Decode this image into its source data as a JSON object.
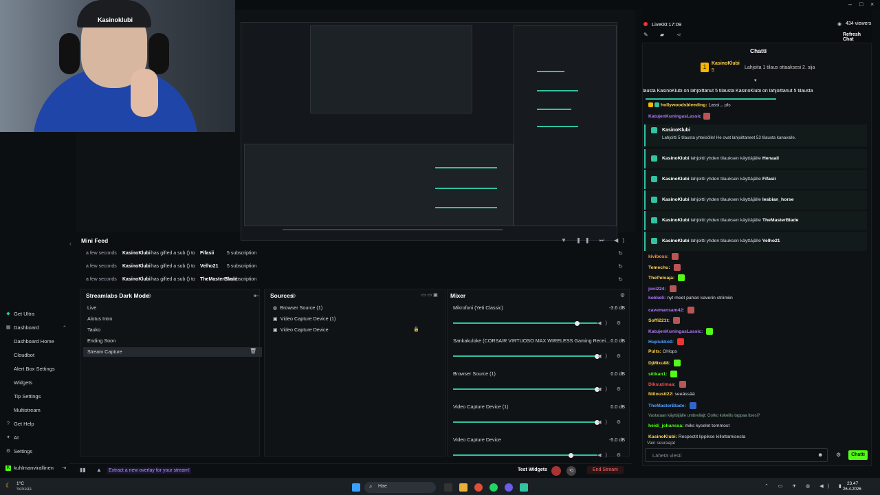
{
  "window": {
    "controls": [
      "–",
      "□",
      "×"
    ]
  },
  "webcam": {
    "cap_text": "Kasinoklubi"
  },
  "nav": {
    "items": [
      {
        "label": "Get Ultra",
        "icon": "ultra-icon"
      },
      {
        "label": "Dashboard",
        "icon": "dashboard-icon",
        "expanded": true
      },
      {
        "label": "Dashboard Home",
        "sub": true
      },
      {
        "label": "Cloudbot",
        "sub": true
      },
      {
        "label": "Alert Box Settings",
        "sub": true
      },
      {
        "label": "Widgets",
        "sub": true
      },
      {
        "label": "Tip Settings",
        "sub": true
      },
      {
        "label": "Multistream",
        "sub": true
      },
      {
        "label": "Get Help",
        "icon": "help-icon"
      },
      {
        "label": "AI",
        "icon": "ai-icon"
      },
      {
        "label": "Settings",
        "icon": "gear-icon"
      },
      {
        "label": "kuhlmanvirallinen",
        "icon": "kick-icon"
      }
    ]
  },
  "minifeed": {
    "title": "Mini Feed",
    "rows": [
      {
        "time": "a few seconds",
        "user": "KasinoKlubi",
        "mid": "has gifted a sub () to",
        "to": "Fifasii",
        "sub": "5 subscription"
      },
      {
        "time": "a few seconds",
        "user": "KasinoKlubi",
        "mid": "has gifted a sub () to",
        "to": "Velho21",
        "sub": "5 subscription"
      },
      {
        "time": "a few seconds",
        "user": "KasinoKlubi",
        "mid": "has gifted a sub () to",
        "to": "TheMasterBlade",
        "sub": "5 subscription"
      }
    ]
  },
  "scenes": {
    "title": "Streamlabs Dark Mode",
    "items": [
      "Live",
      "Alotus Intro",
      "Tauko",
      "Ending Soon",
      "Stream Capture"
    ],
    "selected_index": 4
  },
  "sources": {
    "title": "Sources",
    "items": [
      "Browser Source (1)",
      "Video Capture Device (1)",
      "Video Capture Device"
    ]
  },
  "mixer": {
    "title": "Mixer",
    "tracks": [
      {
        "name": "Mikrofoni (Yeti Classic)",
        "db": "-3.6 dB",
        "level": 0.86
      },
      {
        "name": "Sankakuloke (CORSAIR VIRTUOSO MAX WIRELESS Gaming Recei...",
        "db": "0.0 dB",
        "level": 1.0
      },
      {
        "name": "Browser Source (1)",
        "db": "0.0 dB",
        "level": 1.0
      },
      {
        "name": "Video Capture Device (1)",
        "db": "0.0 dB",
        "level": 1.0
      },
      {
        "name": "Video Capture Device",
        "db": "-5.0 dB",
        "level": 0.82
      }
    ]
  },
  "bottombar": {
    "extract_label": "Extract a new overlay for your stream!",
    "test_label": "Test Widgets",
    "end_label": "End Stream"
  },
  "chatheader": {
    "live_label": "Live",
    "uptime": "00:17:09",
    "viewers": "434 viewers",
    "refresh_label": "Refresh Chat",
    "title": "Chatti",
    "pinned_user": "KasinoKlubi",
    "pinned_count": "5",
    "pinned_text": "Lahjoita 1 tilaus ottaaksesi 2. sija"
  },
  "chat": {
    "ticker": "lausta  KasinoKlubi on lahjoittanut 5 tilausta  KasinoKlubi on lahjoittanut 5 tilausta",
    "lines_top": [
      {
        "user": "hollywoodsbleeding:",
        "text": "Lassi... pls",
        "color": "#ffd34d"
      },
      {
        "user": "KatujenKuningasLassic",
        "text": "",
        "color": "#b07bff"
      }
    ],
    "gift_main": {
      "user": "KasinoKlubi",
      "text": "Lahjoitti 5 tilausta yhteisölle! He ovat lahjoittaneet 53 tilausta kanavalle."
    },
    "gifts": [
      {
        "user": "KasinoKlubi",
        "mid": "lahjoitti yhden tilauksen käyttäjälle",
        "to": "Henaali"
      },
      {
        "user": "KasinoKlubi",
        "mid": "lahjoitti yhden tilauksen käyttäjälle",
        "to": "Fifasii"
      },
      {
        "user": "KasinoKlubi",
        "mid": "lahjoitti yhden tilauksen käyttäjälle",
        "to": "lesbian_horse"
      },
      {
        "user": "KasinoKlubi",
        "mid": "lahjoitti yhden tilauksen käyttäjälle",
        "to": "TheMasterBlade"
      },
      {
        "user": "KasinoKlubi",
        "mid": "lahjoitti yhden tilauksen käyttäjälle",
        "to": "Velho21"
      }
    ],
    "messages": [
      {
        "user": "kiviboss:",
        "text": "",
        "color": "#ff9a3d"
      },
      {
        "user": "Temechu:",
        "text": "",
        "color": "#ffd34d"
      },
      {
        "user": "ThePeloaja:",
        "text": "",
        "color": "#ffd34d"
      },
      {
        "user": "joni224:",
        "text": "",
        "color": "#b07bff"
      },
      {
        "user": "kokkeli:",
        "text": "nyt meet pahan kaverin striimiin",
        "color": "#b07bff"
      },
      {
        "user": "cavemansam42:",
        "text": "",
        "color": "#b07bff"
      },
      {
        "user": "Soffi221t:",
        "text": "",
        "color": "#ffd34d"
      },
      {
        "user": "KatujenKuningasLassic:",
        "text": "",
        "color": "#b07bff"
      },
      {
        "user": "Hupiukko0:",
        "text": "",
        "color": "#4da3ff"
      },
      {
        "user": "Pults:",
        "text": "OHops",
        "color": "#ffd34d"
      },
      {
        "user": "DjMixu88:",
        "text": "",
        "color": "#ffd34d"
      },
      {
        "user": "sitikan1:",
        "text": "",
        "color": "#53fc18"
      },
      {
        "user": "Diksuzimaa:",
        "text": "",
        "color": "#ff4d4d"
      },
      {
        "user": "Niilousti22:",
        "text": "seeässää",
        "color": "#ffd34d"
      },
      {
        "user": "TheMasterBlade:",
        "text": "",
        "color": "#4da3ff"
      },
      {
        "user": "",
        "text": "Vastataan käyttäjälle umbrellajt: Ootko kokeillu tappaa itsesi?",
        "color": "#8a9"
      },
      {
        "user": "heidi_johanssa:",
        "text": "miks kyselet tommost",
        "color": "#53fc18"
      },
      {
        "user": "KasinoKlubi:",
        "text": "Respectit lippikse killottamisesta",
        "color": "#ffd34d"
      }
    ],
    "followers_only": "Vain seuraajat",
    "input_placeholder": "Lähetä viesti",
    "send_label": "Chatti"
  },
  "taskbar": {
    "weather_temp": "1°C",
    "weather_desc": "Selkeää",
    "search_placeholder": "Hae",
    "time": "23.47",
    "date": "26.4.2026"
  }
}
